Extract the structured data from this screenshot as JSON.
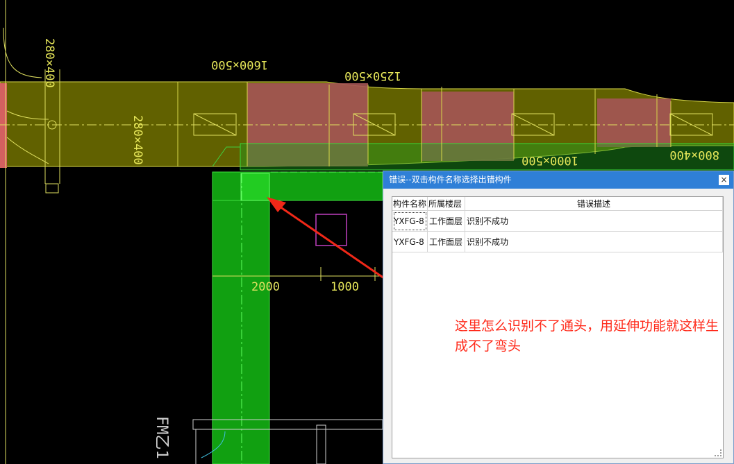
{
  "cad": {
    "labels": {
      "duct_left_vertical": "280×400",
      "duct_left_middle": "280×400",
      "duct_top_1": "1600×500",
      "duct_top_2": "1250×500",
      "duct_right_1": "1000×500",
      "duct_right_2": "800×400",
      "dim_2000": "2000",
      "dim_1000": "1000",
      "door_label": "FM乙1"
    },
    "colors": {
      "duct_yellow": "#8a8a10",
      "duct_pink": "#b05a5a",
      "duct_green": "#1fa51f",
      "line_yellow": "#e8e85a",
      "highlight_green": "#22d022",
      "magenta": "#c040c0",
      "arrow_red": "#f03020"
    }
  },
  "dialog": {
    "title": "错误--双击构件名称选择出错构件",
    "close_label": "×",
    "columns": [
      "构件名称",
      "所属楼层",
      "错误描述"
    ],
    "rows": [
      {
        "name": "YXFG-8",
        "floor": "工作面层",
        "desc": "识别不成功"
      },
      {
        "name": "YXFG-8",
        "floor": "工作面层",
        "desc": "识别不成功"
      }
    ]
  },
  "annotation": {
    "text": "这里怎么识别不了通头，用延伸功能就这样生成不了弯头"
  }
}
